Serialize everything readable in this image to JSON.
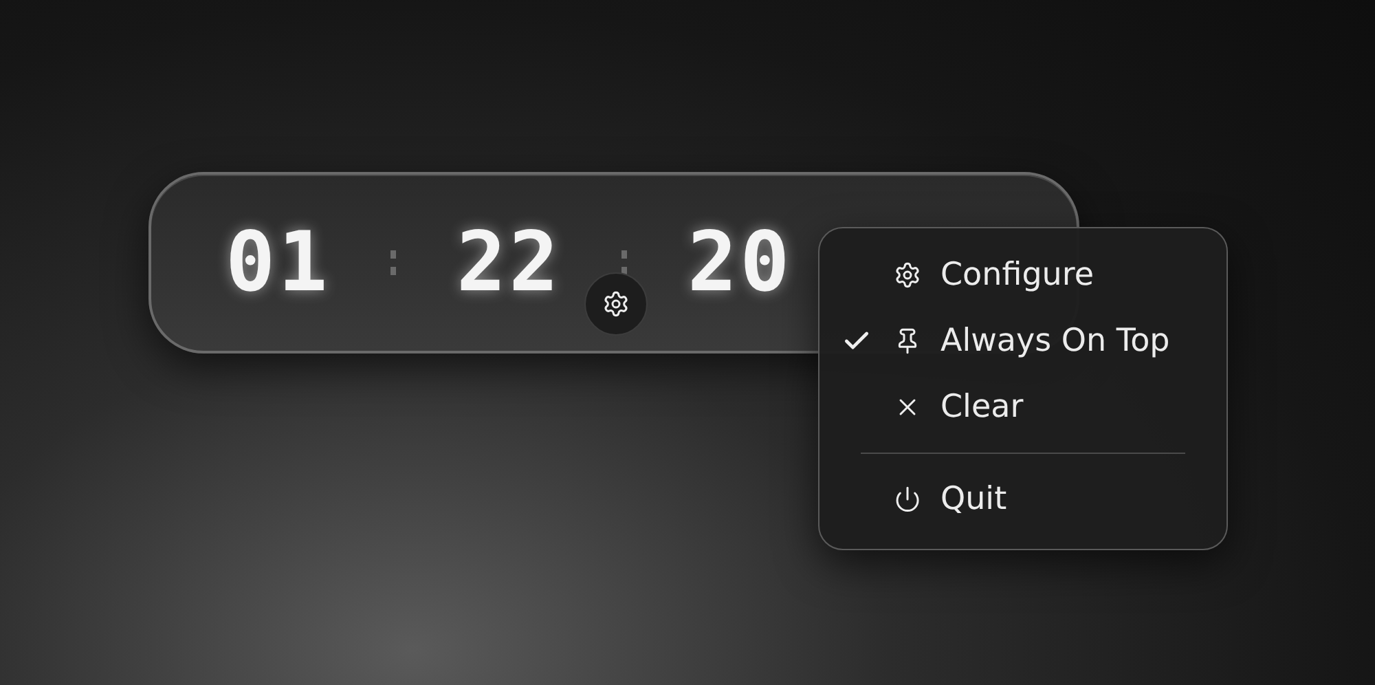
{
  "timer": {
    "segments": [
      "01",
      "22",
      "20"
    ]
  },
  "menu": {
    "items": [
      {
        "kind": "action",
        "label": "Configure",
        "checked": false
      },
      {
        "kind": "action",
        "label": "Always On Top",
        "checked": true
      },
      {
        "kind": "action",
        "label": "Clear",
        "checked": false
      },
      {
        "kind": "divider"
      },
      {
        "kind": "action",
        "label": "Quit",
        "checked": false
      }
    ]
  }
}
